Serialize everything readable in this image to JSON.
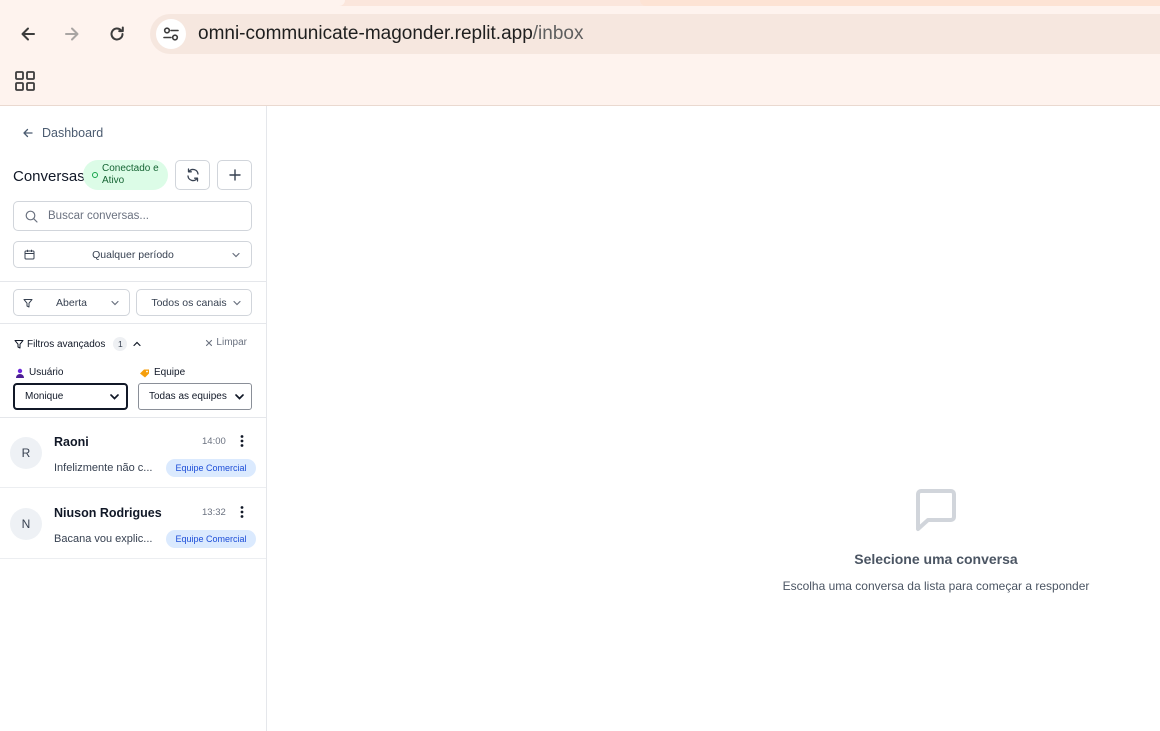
{
  "browser": {
    "url_host": "omni-communicate-magonder.replit.app",
    "url_path": "/inbox",
    "icons": [
      "back-arrow-icon",
      "forward-arrow-icon",
      "reload-icon",
      "site-info-icon",
      "apps-grid-icon"
    ]
  },
  "sidebar": {
    "back_label": "Dashboard",
    "title": "Conversas",
    "status_line1": "Conectado e",
    "status_line2": "Ativo",
    "search_placeholder": "Buscar conversas...",
    "period_label": "Qualquer período",
    "status_filter": "Aberta",
    "channel_filter": "Todos os canais",
    "advanced_filters_label": "Filtros avançados",
    "advanced_filters_count": "1",
    "clear_label": "Limpar",
    "user_label": "Usuário",
    "user_value": "Monique",
    "team_label": "Equipe",
    "team_value": "Todas as equipes",
    "conversations": [
      {
        "initial": "R",
        "name": "Raoni",
        "time": "14:00",
        "preview": "Infelizmente não c...",
        "team": "Equipe Comercial"
      },
      {
        "initial": "N",
        "name": "Niuson Rodrigues",
        "time": "13:32",
        "preview": "Bacana vou explic...",
        "team": "Equipe Comercial"
      }
    ]
  },
  "main": {
    "empty_title": "Selecione uma conversa",
    "empty_subtitle": "Escolha uma conversa da lista para começar a responder"
  },
  "colors": {
    "browser_bg": "#fef3ee",
    "status_badge_bg": "#dcfce7",
    "team_badge_bg": "#dbeafe",
    "team_badge_text": "#1d4ed8"
  }
}
